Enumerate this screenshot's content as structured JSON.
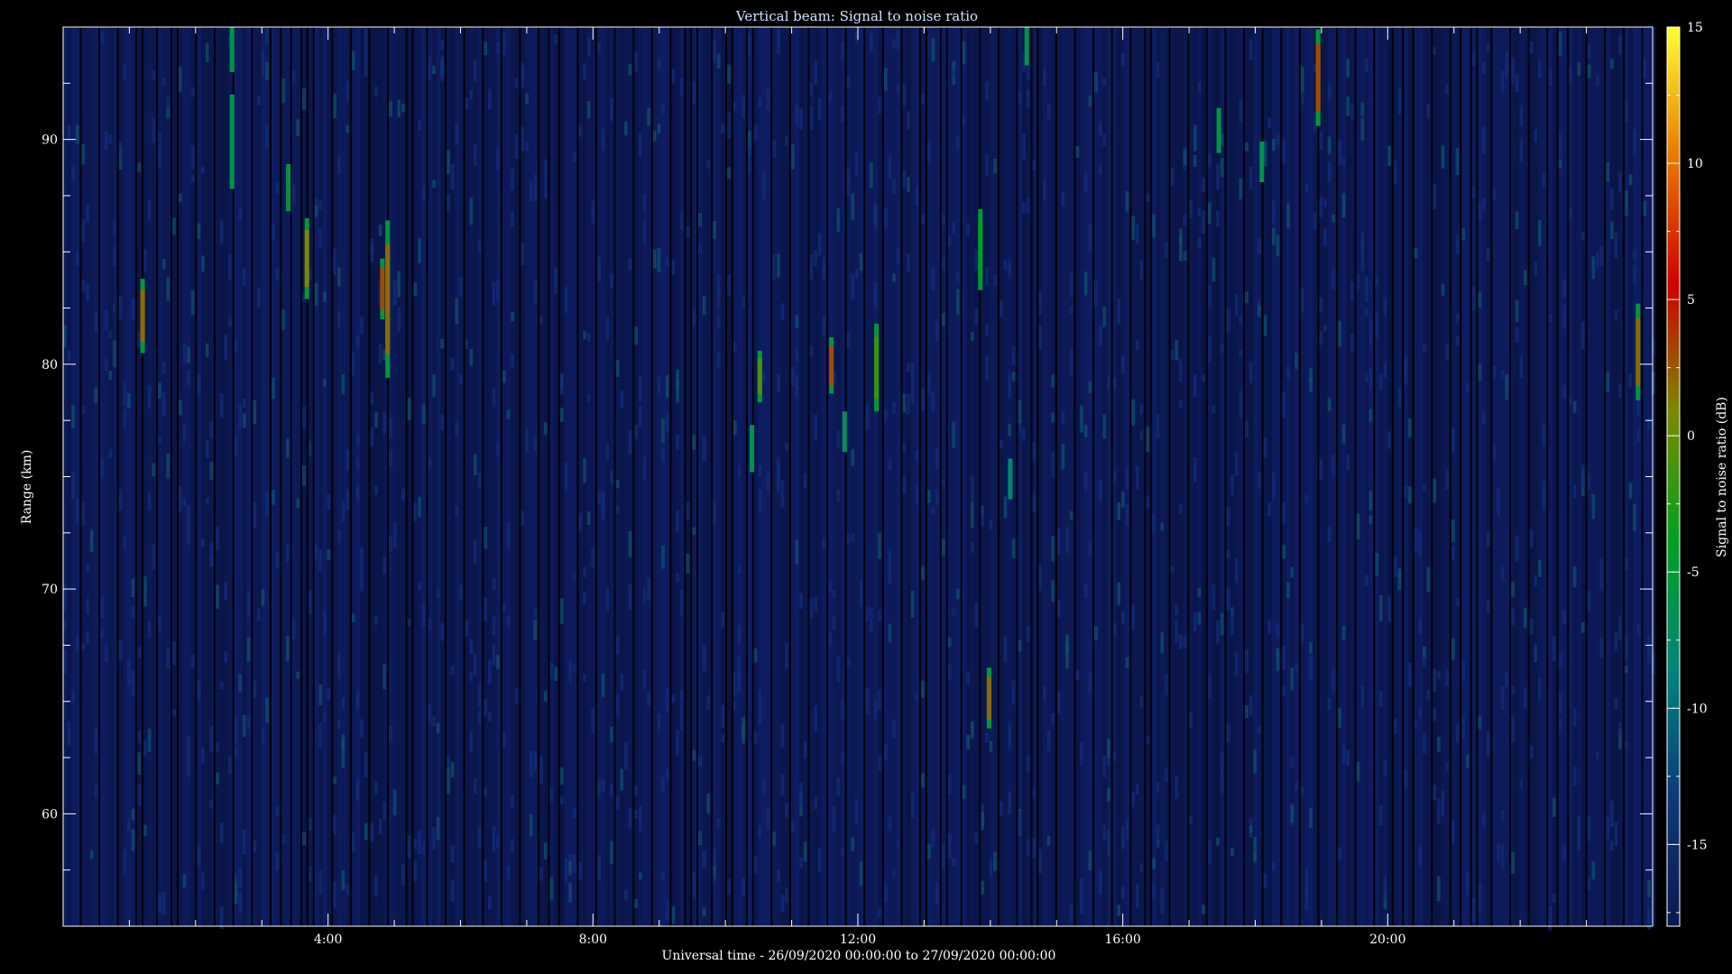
{
  "chart_data": {
    "type": "heatmap",
    "title": "Vertical beam: Signal to noise ratio",
    "xlabel": "Universal time - 26/09/2020 00:00:00 to 27/09/2020 00:00:00",
    "ylabel": "Range (km)",
    "colorbar_label": "Signal to noise ratio (dB)",
    "x_range_hours": [
      0,
      24
    ],
    "y_range_km": [
      55,
      95
    ],
    "x_ticks": [
      {
        "hour": 4,
        "label": "4:00"
      },
      {
        "hour": 8,
        "label": "8:00"
      },
      {
        "hour": 12,
        "label": "12:00"
      },
      {
        "hour": 16,
        "label": "16:00"
      },
      {
        "hour": 20,
        "label": "20:00"
      }
    ],
    "y_ticks": [
      {
        "km": 60,
        "label": "60"
      },
      {
        "km": 70,
        "label": "70"
      },
      {
        "km": 80,
        "label": "80"
      },
      {
        "km": 90,
        "label": "90"
      }
    ],
    "colorbar_range_db": [
      -18,
      15
    ],
    "colorbar_ticks": [
      {
        "db": 15,
        "label": "15"
      },
      {
        "db": 10,
        "label": "10"
      },
      {
        "db": 5,
        "label": "5"
      },
      {
        "db": 0,
        "label": "0"
      },
      {
        "db": -5,
        "label": "-5"
      },
      {
        "db": -10,
        "label": "-10"
      },
      {
        "db": -15,
        "label": "-15"
      }
    ],
    "colormap": [
      "#0a1850",
      "#0c3a7a",
      "#00857a",
      "#00a020",
      "#7a8a00",
      "#d00000",
      "#e87a00",
      "#ffff30"
    ],
    "background_db": -15,
    "strong_echoes": [
      {
        "t": 1.2,
        "km0": 80.5,
        "km1": 83.8,
        "db": 2
      },
      {
        "t": 2.55,
        "km0": 93.0,
        "km1": 95.0,
        "db": -6
      },
      {
        "t": 2.55,
        "km0": 87.8,
        "km1": 92.0,
        "db": -6
      },
      {
        "t": 3.4,
        "km0": 86.8,
        "km1": 88.9,
        "db": -6
      },
      {
        "t": 3.68,
        "km0": 82.9,
        "km1": 86.5,
        "db": 1
      },
      {
        "t": 4.82,
        "km0": 82.0,
        "km1": 84.7,
        "db": 3
      },
      {
        "t": 4.9,
        "km0": 79.4,
        "km1": 86.4,
        "db": 2
      },
      {
        "t": 10.4,
        "km0": 75.2,
        "km1": 77.3,
        "db": -6
      },
      {
        "t": 10.52,
        "km0": 78.3,
        "km1": 80.6,
        "db": -1
      },
      {
        "t": 11.6,
        "km0": 78.7,
        "km1": 81.2,
        "db": 3
      },
      {
        "t": 11.8,
        "km0": 76.1,
        "km1": 77.9,
        "db": -7
      },
      {
        "t": 12.28,
        "km0": 77.9,
        "km1": 81.8,
        "db": -2
      },
      {
        "t": 13.85,
        "km0": 83.3,
        "km1": 86.9,
        "db": -4
      },
      {
        "t": 13.98,
        "km0": 63.8,
        "km1": 66.5,
        "db": 2
      },
      {
        "t": 14.3,
        "km0": 74.0,
        "km1": 75.8,
        "db": -8
      },
      {
        "t": 14.55,
        "km0": 93.3,
        "km1": 95.0,
        "db": -6
      },
      {
        "t": 17.45,
        "km0": 89.4,
        "km1": 91.4,
        "db": -6
      },
      {
        "t": 18.1,
        "km0": 88.1,
        "km1": 89.9,
        "db": -6
      },
      {
        "t": 18.95,
        "km0": 90.6,
        "km1": 94.9,
        "db": 3
      },
      {
        "t": 23.78,
        "km0": 78.4,
        "km1": 82.7,
        "db": 2
      }
    ]
  }
}
